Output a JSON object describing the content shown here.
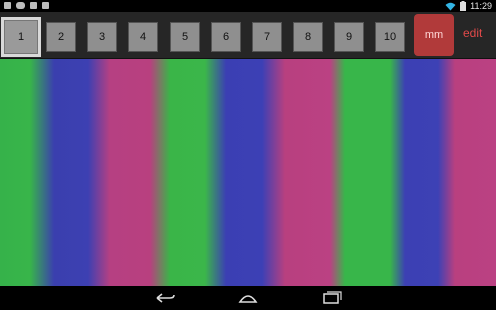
{
  "status_bar": {
    "time": "11:29",
    "icons": [
      "phone-icon",
      "gamepad-icon",
      "checkbox-icon",
      "download-icon",
      "wifi-icon",
      "battery-icon"
    ]
  },
  "toolbar": {
    "buttons": [
      "1",
      "2",
      "3",
      "4",
      "5",
      "6",
      "7",
      "8",
      "9",
      "10"
    ],
    "selected": "1",
    "mm_label": "mm",
    "edit_label": "edit"
  },
  "stripes": {
    "pattern": [
      "green",
      "blue",
      "magenta",
      "green",
      "blue",
      "magenta",
      "green",
      "blue",
      "magenta"
    ],
    "colors": {
      "green": "#38b54a",
      "blue": "#3c40b3",
      "magenta": "#b9407f"
    }
  },
  "nav_bar": {
    "icons": [
      "back-icon",
      "home-icon",
      "recents-icon"
    ]
  }
}
